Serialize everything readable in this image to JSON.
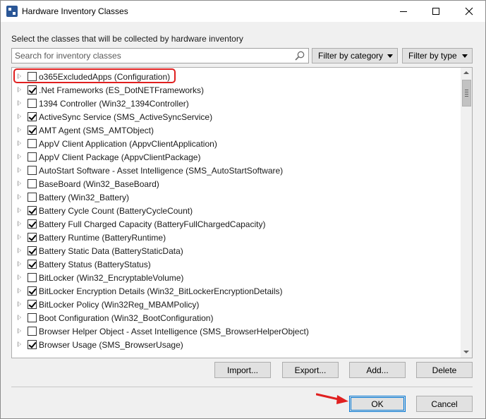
{
  "window": {
    "title": "Hardware Inventory Classes"
  },
  "instruction": "Select the classes that will be collected by hardware inventory",
  "search": {
    "placeholder": "Search for inventory classes",
    "value": ""
  },
  "filters": {
    "category_label": "Filter by category",
    "type_label": "Filter by type"
  },
  "classes": [
    {
      "label": "o365ExcludedApps (Configuration)",
      "checked": false,
      "highlighted": true
    },
    {
      "label": ".Net Frameworks (ES_DotNETFrameworks)",
      "checked": true
    },
    {
      "label": "1394 Controller (Win32_1394Controller)",
      "checked": false
    },
    {
      "label": "ActiveSync Service (SMS_ActiveSyncService)",
      "checked": true
    },
    {
      "label": "AMT Agent (SMS_AMTObject)",
      "checked": true
    },
    {
      "label": "AppV Client Application (AppvClientApplication)",
      "checked": false
    },
    {
      "label": "AppV Client Package (AppvClientPackage)",
      "checked": false
    },
    {
      "label": "AutoStart Software - Asset Intelligence (SMS_AutoStartSoftware)",
      "checked": false
    },
    {
      "label": "BaseBoard (Win32_BaseBoard)",
      "checked": false
    },
    {
      "label": "Battery (Win32_Battery)",
      "checked": false
    },
    {
      "label": "Battery Cycle Count (BatteryCycleCount)",
      "checked": true
    },
    {
      "label": "Battery Full Charged Capacity (BatteryFullChargedCapacity)",
      "checked": true
    },
    {
      "label": "Battery Runtime (BatteryRuntime)",
      "checked": true
    },
    {
      "label": "Battery Static Data (BatteryStaticData)",
      "checked": true
    },
    {
      "label": "Battery Status (BatteryStatus)",
      "checked": true
    },
    {
      "label": "BitLocker (Win32_EncryptableVolume)",
      "checked": false
    },
    {
      "label": "BitLocker Encryption Details (Win32_BitLockerEncryptionDetails)",
      "checked": true
    },
    {
      "label": "BitLocker Policy (Win32Reg_MBAMPolicy)",
      "checked": true
    },
    {
      "label": "Boot Configuration (Win32_BootConfiguration)",
      "checked": false
    },
    {
      "label": "Browser Helper Object - Asset Intelligence (SMS_BrowserHelperObject)",
      "checked": false
    },
    {
      "label": "Browser Usage (SMS_BrowserUsage)",
      "checked": true
    }
  ],
  "buttons": {
    "import": "Import...",
    "export": "Export...",
    "add": "Add...",
    "delete": "Delete",
    "ok": "OK",
    "cancel": "Cancel"
  },
  "colors": {
    "highlight": "#e02020",
    "ok_border": "#0078d7"
  }
}
